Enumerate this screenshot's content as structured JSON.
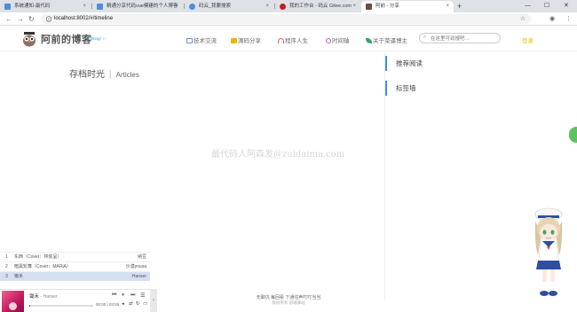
{
  "browser": {
    "tabs": [
      {
        "label": "系统通知-最代码",
        "color": "#4e8fd6"
      },
      {
        "label": "精通分享代码vue模建的个人博客",
        "color": "#4e8fd6"
      },
      {
        "label": "码云_我要搜索",
        "color": "#4a90d9"
      },
      {
        "label": "我的工作台 - 码云 Gitee.com",
        "color": "#c71d23"
      },
      {
        "label": "阿前 - 分享",
        "color": "#6d4c41"
      }
    ],
    "new_tab": "+",
    "window_controls": {
      "minimize": "—",
      "maximize": "☐",
      "close": "✕"
    },
    "url": "localhost:8002/#/timeline",
    "nav": {
      "back": "←",
      "forward": "→",
      "reload": "↻"
    }
  },
  "site": {
    "title": "阿前的博客",
    "motto": "fighting! ↑↑",
    "nav": [
      {
        "label": "技术交流",
        "color": "#6b8ed6"
      },
      {
        "label": "源码分享",
        "color": "#e6b800"
      },
      {
        "label": "程序人生",
        "color": "#e05a5a"
      },
      {
        "label": "时间轴",
        "color": "#b35ad6"
      },
      {
        "label": "关于菜逼博主",
        "color": "#3aa36b"
      }
    ],
    "search_placeholder": "在这里可劲搜吧…",
    "login": "登录"
  },
  "main": {
    "archive_title": "存档时光",
    "archive_sep": "|",
    "archive_en": "Articles",
    "watermark": "最代码人阿森发@zuidaima.com"
  },
  "sidebar": {
    "recommend": "推荐阅读",
    "tags": "标签墙"
  },
  "player": {
    "playlist": [
      {
        "num": "1",
        "title": "东西（Cover：林俊呈）",
        "artist": "纳豆"
      },
      {
        "num": "2",
        "title": "暗黑轮舞（Cover：MARiA）",
        "artist": "沙漠yousa"
      },
      {
        "num": "3",
        "title": "锄禾",
        "artist": "Hanser"
      }
    ],
    "current_title": "锄禾",
    "current_artist": " - Hanser",
    "time": "00:00 / 03:55",
    "progress": 0.02
  },
  "footer": {
    "line1": "无聊坑 每回看 下通往声叮叮当当",
    "line2": "版权所有 前端驿站"
  }
}
